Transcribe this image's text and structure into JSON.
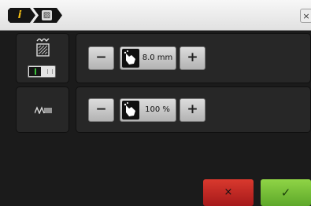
{
  "header": {
    "crumbs": [
      {
        "icon": "info-icon",
        "glyph": "i",
        "color": "#f2bd14"
      },
      {
        "icon": "spool-icon",
        "glyph": "▨",
        "color": "#2b2b2b"
      }
    ],
    "close_label": "×"
  },
  "rows": [
    {
      "icon": "fabric-stitch-icon",
      "toggle_state": "on",
      "minus_label": "−",
      "value": "8.0 mm",
      "plus_label": "+"
    },
    {
      "icon": "zigzag-stitch-icon",
      "minus_label": "−",
      "value": "100 %",
      "plus_label": "+"
    }
  ],
  "footer": {
    "cancel_label": "×",
    "ok_label": "✓"
  },
  "colors": {
    "cancel": "#c0281f",
    "ok": "#7cc13c",
    "toggle_on": "#3bc23b"
  }
}
